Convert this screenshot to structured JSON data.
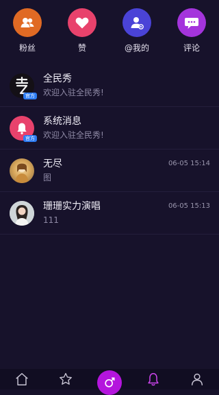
{
  "top_nav": [
    {
      "label": "粉丝",
      "icon": "fans-icon",
      "color": "#e06a24"
    },
    {
      "label": "赞",
      "icon": "heart-icon",
      "color": "#e8426c"
    },
    {
      "label": "@我的",
      "icon": "mention-icon",
      "color": "#4a43d7"
    },
    {
      "label": "评论",
      "icon": "comment-icon",
      "color": "#a434dc"
    }
  ],
  "messages": [
    {
      "title": "全民秀",
      "subtitle": "欢迎入驻全民秀!",
      "badge": "官方",
      "time": ""
    },
    {
      "title": "系统消息",
      "subtitle": "欢迎入驻全民秀!",
      "badge": "官方",
      "time": ""
    },
    {
      "title": "无尽",
      "subtitle": "图",
      "badge": "",
      "time": "06-05 15:14"
    },
    {
      "title": "珊珊实力演唱",
      "subtitle": "111",
      "badge": "",
      "time": "06-05 15:13"
    }
  ],
  "bottom_tabs": [
    "home-icon",
    "star-icon",
    "record-icon",
    "bell-icon",
    "profile-icon"
  ],
  "colors": {
    "background": "#17122b",
    "bottom_bar": "#110d22",
    "accent": "#b415dd",
    "official_badge": "#2d7cf3"
  }
}
